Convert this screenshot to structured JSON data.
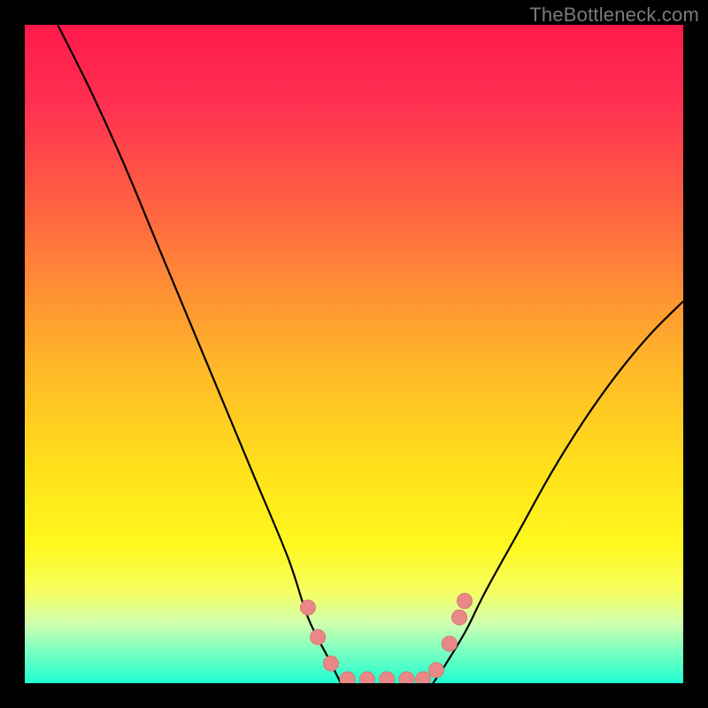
{
  "watermark": "TheBottleneck.com",
  "chart_data": {
    "type": "line",
    "title": "",
    "xlabel": "",
    "ylabel": "",
    "xlim": [
      0,
      100
    ],
    "ylim": [
      0,
      100
    ],
    "grid": false,
    "legend": false,
    "series": [
      {
        "name": "left-curve",
        "x": [
          5,
          10,
          15,
          20,
          25,
          30,
          35,
          40,
          43,
          46,
          48
        ],
        "y": [
          100,
          90,
          79,
          67,
          55,
          43,
          31,
          19,
          10,
          4,
          0
        ]
      },
      {
        "name": "right-curve",
        "x": [
          62,
          64,
          67,
          70,
          75,
          80,
          85,
          90,
          95,
          100
        ],
        "y": [
          0,
          3,
          8,
          14,
          23,
          32,
          40,
          47,
          53,
          58
        ]
      },
      {
        "name": "floor-segment",
        "x": [
          48,
          62
        ],
        "y": [
          0,
          0
        ]
      }
    ],
    "markers": {
      "name": "pink-dots",
      "points": [
        {
          "x": 43.0,
          "y": 11.5
        },
        {
          "x": 44.5,
          "y": 7.0
        },
        {
          "x": 46.5,
          "y": 3.0
        },
        {
          "x": 49.0,
          "y": 0.6
        },
        {
          "x": 52.0,
          "y": 0.6
        },
        {
          "x": 55.0,
          "y": 0.6
        },
        {
          "x": 58.0,
          "y": 0.6
        },
        {
          "x": 60.5,
          "y": 0.6
        },
        {
          "x": 62.5,
          "y": 2.0
        },
        {
          "x": 64.5,
          "y": 6.0
        },
        {
          "x": 66.0,
          "y": 10.0
        },
        {
          "x": 66.8,
          "y": 12.5
        }
      ]
    },
    "gradient_stops": [
      {
        "offset": 0.0,
        "color": "#ff1a4b"
      },
      {
        "offset": 0.12,
        "color": "#ff3051"
      },
      {
        "offset": 0.3,
        "color": "#ff6a3f"
      },
      {
        "offset": 0.5,
        "color": "#ffb22a"
      },
      {
        "offset": 0.68,
        "color": "#ffe21a"
      },
      {
        "offset": 0.79,
        "color": "#fff81f"
      },
      {
        "offset": 0.86,
        "color": "#f6ff60"
      },
      {
        "offset": 0.91,
        "color": "#cfffb0"
      },
      {
        "offset": 0.95,
        "color": "#7dffc0"
      },
      {
        "offset": 1.0,
        "color": "#1fffd0"
      }
    ],
    "colors": {
      "curve": "#000000",
      "marker_fill": "#e98887",
      "marker_stroke": "#d77776",
      "background_frame": "#000000"
    }
  }
}
